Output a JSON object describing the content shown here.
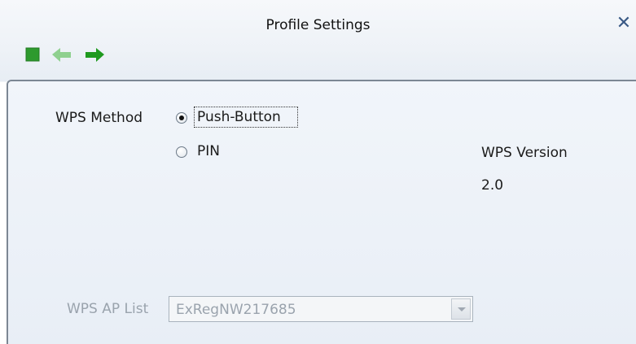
{
  "window": {
    "title": "Profile Settings",
    "close_glyph": "✕",
    "close_icon": "close-icon"
  },
  "toolbar": {
    "buttons": [
      {
        "icon": "stop-icon",
        "color": "#2e9a2e"
      },
      {
        "icon": "back-arrow-icon",
        "color": "#8fd08f",
        "enabled": false
      },
      {
        "icon": "forward-arrow-icon",
        "color": "#1f9a1f",
        "enabled": true
      }
    ]
  },
  "wps": {
    "method_label": "WPS Method",
    "options": [
      {
        "label": "Push-Button",
        "selected": true
      },
      {
        "label": "PIN",
        "selected": false
      }
    ],
    "version_label": "WPS Version",
    "version_value": "2.0",
    "ap_list_label": "WPS AP List",
    "ap_list_value": "ExRegNW217685"
  },
  "colors": {
    "panel_border": "#7c8794",
    "disabled_text": "#9aa3ad",
    "close_icon": "#3a5a86"
  }
}
